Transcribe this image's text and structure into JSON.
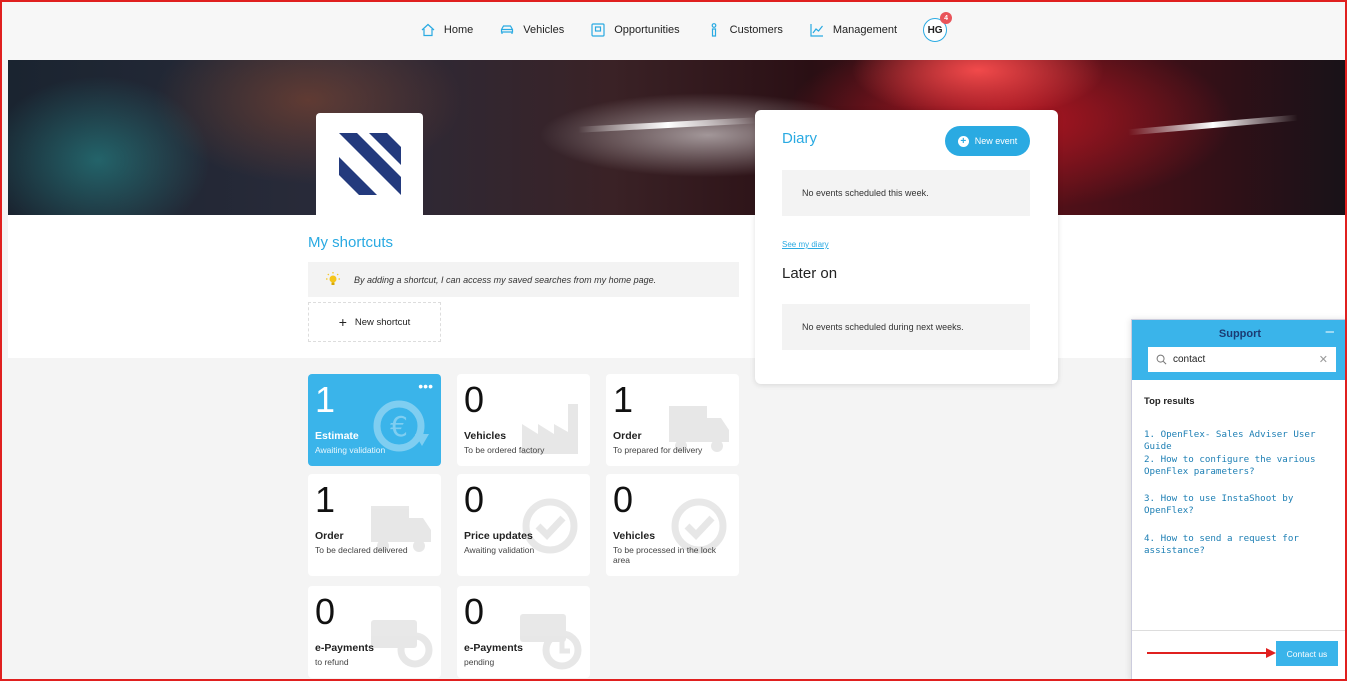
{
  "nav": {
    "items": [
      {
        "label": "Home",
        "icon": "home-icon"
      },
      {
        "label": "Vehicles",
        "icon": "car-icon"
      },
      {
        "label": "Opportunities",
        "icon": "opportunity-icon"
      },
      {
        "label": "Customers",
        "icon": "person-icon"
      },
      {
        "label": "Management",
        "icon": "chart-icon"
      }
    ],
    "avatar_initials": "HG",
    "notification_count": "4"
  },
  "shortcuts": {
    "title": "My shortcuts",
    "hint": "By adding a shortcut, I can access my saved searches from my home page.",
    "new_label": "New shortcut"
  },
  "diary": {
    "title": "Diary",
    "new_event_label": "New event",
    "this_week_text": "No events scheduled this week.",
    "see_link": "See my diary",
    "later_title": "Later on",
    "later_text": "No events scheduled during next weeks."
  },
  "tiles": [
    {
      "num": "1",
      "label": "Estimate",
      "sub": "Awaiting validation",
      "icon": "euro-refresh-icon",
      "active": true
    },
    {
      "num": "0",
      "label": "Vehicles",
      "sub": "To be ordered factory",
      "icon": "factory-icon"
    },
    {
      "num": "1",
      "label": "Order",
      "sub": "To prepared for delivery",
      "icon": "truck-icon"
    },
    {
      "num": "1",
      "label": "Order",
      "sub": "To be declared delivered",
      "icon": "truck-check-icon"
    },
    {
      "num": "0",
      "label": "Price updates",
      "sub": "Awaiting validation",
      "icon": "refresh-check-icon"
    },
    {
      "num": "0",
      "label": "Vehicles",
      "sub": "To be processed in the lock area",
      "icon": "refresh-check-icon"
    },
    {
      "num": "0",
      "label": "e-Payments",
      "sub": "to refund",
      "icon": "money-refresh-icon"
    },
    {
      "num": "0",
      "label": "e-Payments",
      "sub": "pending",
      "icon": "money-clock-icon"
    }
  ],
  "support": {
    "title": "Support",
    "search_value": "contact",
    "top_results_label": "Top results",
    "results": [
      "1. OpenFlex- Sales Adviser User Guide",
      "2. How to configure the various OpenFlex parameters?",
      "3. How to use InstaShoot by OpenFlex?",
      "4. How to send a request for assistance?"
    ],
    "contact_label": "Contact us"
  },
  "colors": {
    "accent": "#3ab4ea",
    "link": "#2aaae2",
    "annotation": "#e0201f"
  }
}
